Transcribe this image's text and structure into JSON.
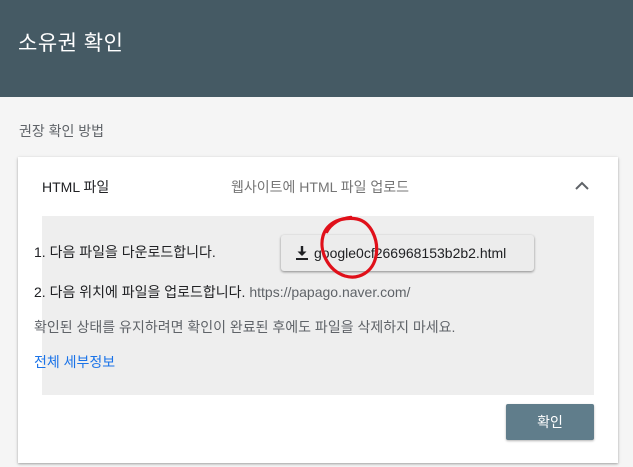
{
  "header": {
    "title": "소유권 확인"
  },
  "section_label": "권장 확인 방법",
  "card": {
    "title": "HTML 파일",
    "subtitle": "웹사이트에 HTML 파일 업로드",
    "steps": {
      "step1_text": "1. 다음 파일을 다운로드합니다.",
      "download_file": "google0cf266968153b2b2.html",
      "step2_text": "2. 다음 위치에 파일을 업로드합니다.",
      "upload_url": "https://papago.naver.com/"
    },
    "note": "확인된 상태를 유지하려면 확인이 완료된 후에도 파일을 삭제하지 마세요.",
    "details_link": "전체 세부정보",
    "confirm_button": "확인"
  },
  "colors": {
    "header_bg": "#455a64",
    "button_primary": "#607d8b",
    "link": "#1a73e8",
    "annotation": "#e0101a"
  },
  "icons": {
    "collapse": "chevron-up-icon",
    "download": "download-icon"
  }
}
